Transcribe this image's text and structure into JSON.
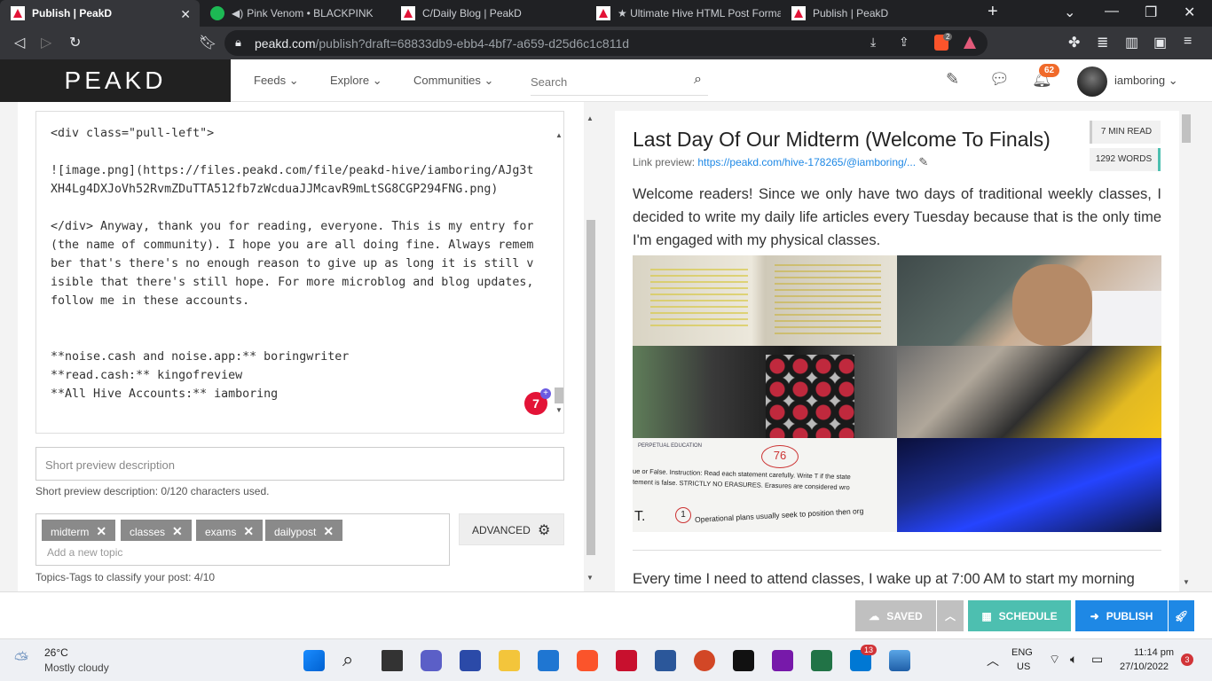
{
  "tabs": [
    {
      "label": "Publish | PeakD",
      "active": true
    },
    {
      "label": "Pink Venom • BLACKPINK"
    },
    {
      "label": "C/Daily Blog | PeakD"
    },
    {
      "label": "★ Ultimate Hive HTML Post Forma"
    },
    {
      "label": "Publish | PeakD"
    }
  ],
  "address": {
    "host": "peakd.com",
    "path": "/publish?draft=68833db9-ebb4-4bf7-a659-d25d6c1c811d",
    "brave_badge": "2"
  },
  "header": {
    "logo": "PEAKD",
    "nav": [
      "Feeds",
      "Explore",
      "Communities"
    ],
    "search_placeholder": "Search",
    "notifications": "62",
    "username": "iamboring"
  },
  "editor": {
    "lines": [
      "<div class=\"pull-left\">",
      "",
      "![image.png](https://files.peakd.com/file/peakd-hive/iamboring/AJg3tXH4Lg4DXJoVh52RvmZDuTTA512fb7zWcduaJJMcavR9mLtSG8CGP294FNG.png)",
      "",
      "</div> Anyway, thank you for reading, everyone. This is my entry for (the name of community). I hope you are all doing fine. Always remember that's there's no enough reason to give up as long it is still visible that there's still hope. For more microblog and blog updates, follow me in these accounts.",
      "",
      "",
      "**noise.cash and noise.app:** boringwriter",
      "**read.cash:** kingofreview",
      "**All Hive Accounts:** iamboring"
    ],
    "issue_count": "7"
  },
  "short_desc": {
    "placeholder": "Short preview description",
    "info": "Short preview description: 0/120 characters used."
  },
  "topics": {
    "tags": [
      "midterm",
      "classes",
      "exams",
      "dailypost"
    ],
    "placeholder": "Add a new topic",
    "info": "Topics-Tags to classify your post: 4/10",
    "advanced_label": "ADVANCED"
  },
  "preview": {
    "title": "Last Day Of Our Midterm (Welcome To Finals)",
    "link_label": "Link preview:",
    "link": "https://peakd.com/hive-178265/@iamboring/...",
    "read_time": "7 MIN READ",
    "words": "1292 WORDS",
    "para1": "Welcome readers! Since we only have two days of traditional weekly classes, I decided to write my daily life articles every Tuesday because that is the only time I'm engaged with my physical classes.",
    "para2": "Every time I need to attend classes, I wake up at 7:00 AM to start my morning",
    "image_texts": [
      "PERPETUAL EDUCATION",
      "ue or False. Instruction: Read each statement carefully. Write T if the state",
      "tement is false. STRICTLY NO ERASURES. Erasures are considered wro",
      "T.",
      "1",
      "Operational plans usually seek to position then org",
      "76"
    ]
  },
  "footer": {
    "saved": "SAVED",
    "schedule": "SCHEDULE",
    "publish": "PUBLISH"
  },
  "taskbar": {
    "temp": "26°C",
    "weather": "Mostly cloudy",
    "lang1": "ENG",
    "lang2": "US",
    "time": "11:14 pm",
    "date": "27/10/2022",
    "notif": "3",
    "teams_badge": "13"
  },
  "colors": {
    "accent": "#e31337",
    "publish": "#1e88e5",
    "schedule": "#4dbfb0",
    "saved": "#c0c0c0"
  }
}
